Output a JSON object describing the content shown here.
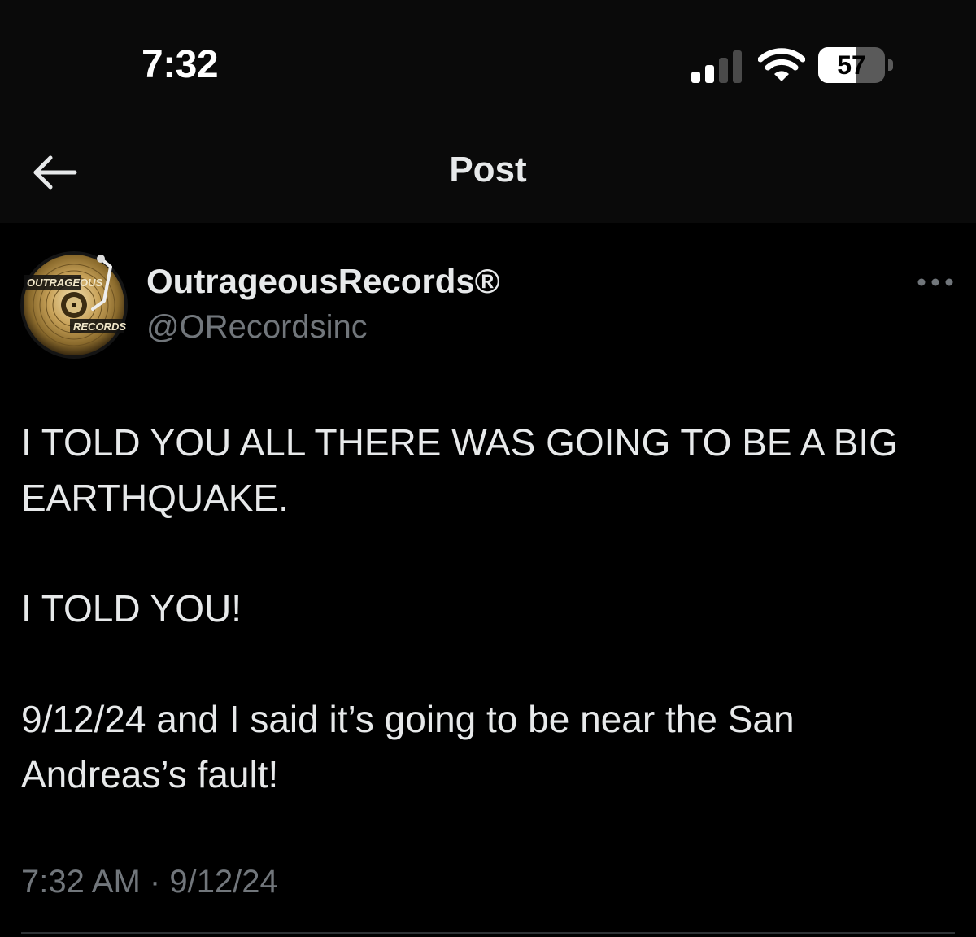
{
  "status_bar": {
    "time": "7:32",
    "signal_bars_active": 2,
    "signal_bars_total": 4,
    "battery_percent": 57,
    "battery_label": "57"
  },
  "header": {
    "title": "Post",
    "back_icon": "arrow-left-icon"
  },
  "post": {
    "author": {
      "display_name": "OutrageousRecords®",
      "handle": "@ORecordsinc",
      "avatar_logo_text_top": "OUTRAGEOUS",
      "avatar_logo_text_bottom": "RECORDS"
    },
    "more_icon": "more-horizontal-icon",
    "paragraphs": [
      "I TOLD YOU ALL THERE WAS GOING TO BE A BIG EARTHQUAKE.",
      "I TOLD YOU!",
      "9/12/24 and I said it’s going to be near the San Andreas’s fault!"
    ],
    "time": "7:32 AM",
    "separator": "·",
    "date": "9/12/24"
  },
  "colors": {
    "background": "#000000",
    "header_background": "#0a0a0a",
    "primary_text": "#e7e9ea",
    "secondary_text": "#71767b",
    "divider": "#2f3336",
    "avatar_gold": "#c9a35a"
  }
}
